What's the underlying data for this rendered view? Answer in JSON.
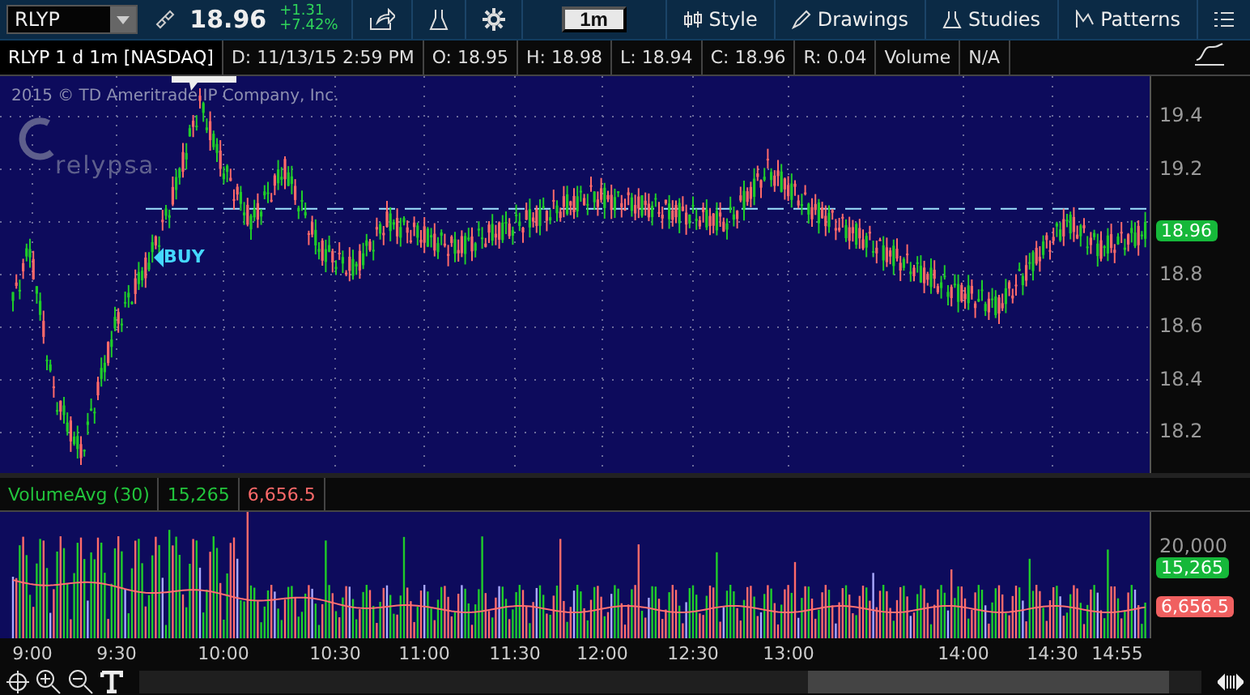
{
  "toolbar": {
    "symbol": "RLYP",
    "price": "18.96",
    "change": "+1.31",
    "change_pct": "+7.42%",
    "timeframe": "1m",
    "buttons": [
      "Style",
      "Drawings",
      "Studies",
      "Patterns"
    ]
  },
  "info_bar": [
    "RLYP 1 d 1m [NASDAQ]",
    "D: 11/13/15 2:59 PM",
    "O: 18.95",
    "H: 18.98",
    "L: 18.94",
    "C: 18.96",
    "R: 0.04",
    "Volume",
    "N/A"
  ],
  "price_chart": {
    "copyright": "2015 © TD Ameritrade IP Company, Inc.",
    "logo": "relypsa",
    "marker": "BUY",
    "axis": [
      "19.4",
      "19.2",
      "18.8",
      "18.6",
      "18.4",
      "18.2"
    ],
    "last_price": "18.96"
  },
  "volume_study": {
    "name": "VolumeAvg (30)",
    "volume": "15,265",
    "average": "6,656.5",
    "axis": [
      "20,000"
    ],
    "volume_badge": "15,265",
    "average_badge": "6,656.5"
  },
  "time_axis": [
    "9:00",
    "9:30",
    "10:00",
    "10:30",
    "11:00",
    "11:30",
    "12:00",
    "12:30",
    "13:00",
    "14:00",
    "14:30",
    "14:55"
  ]
}
